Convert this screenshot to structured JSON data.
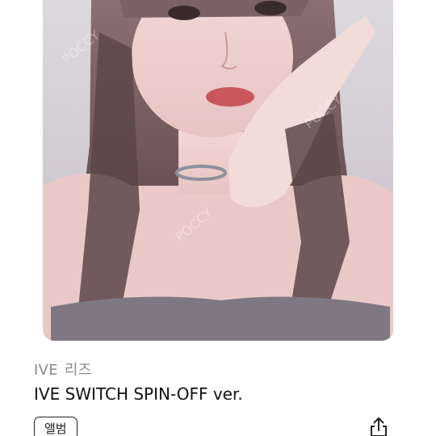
{
  "product": {
    "group": "IVE",
    "member": "리즈",
    "title": "IVE SWITCH SPIN-OFF ver.",
    "category_badge": "앨범"
  },
  "watermark": "POCCY 포카마켓",
  "icons": {
    "share": "share-icon"
  },
  "colors": {
    "title": "#111111",
    "subtitle": "#8a8a8a",
    "badge_border": "#222222"
  }
}
